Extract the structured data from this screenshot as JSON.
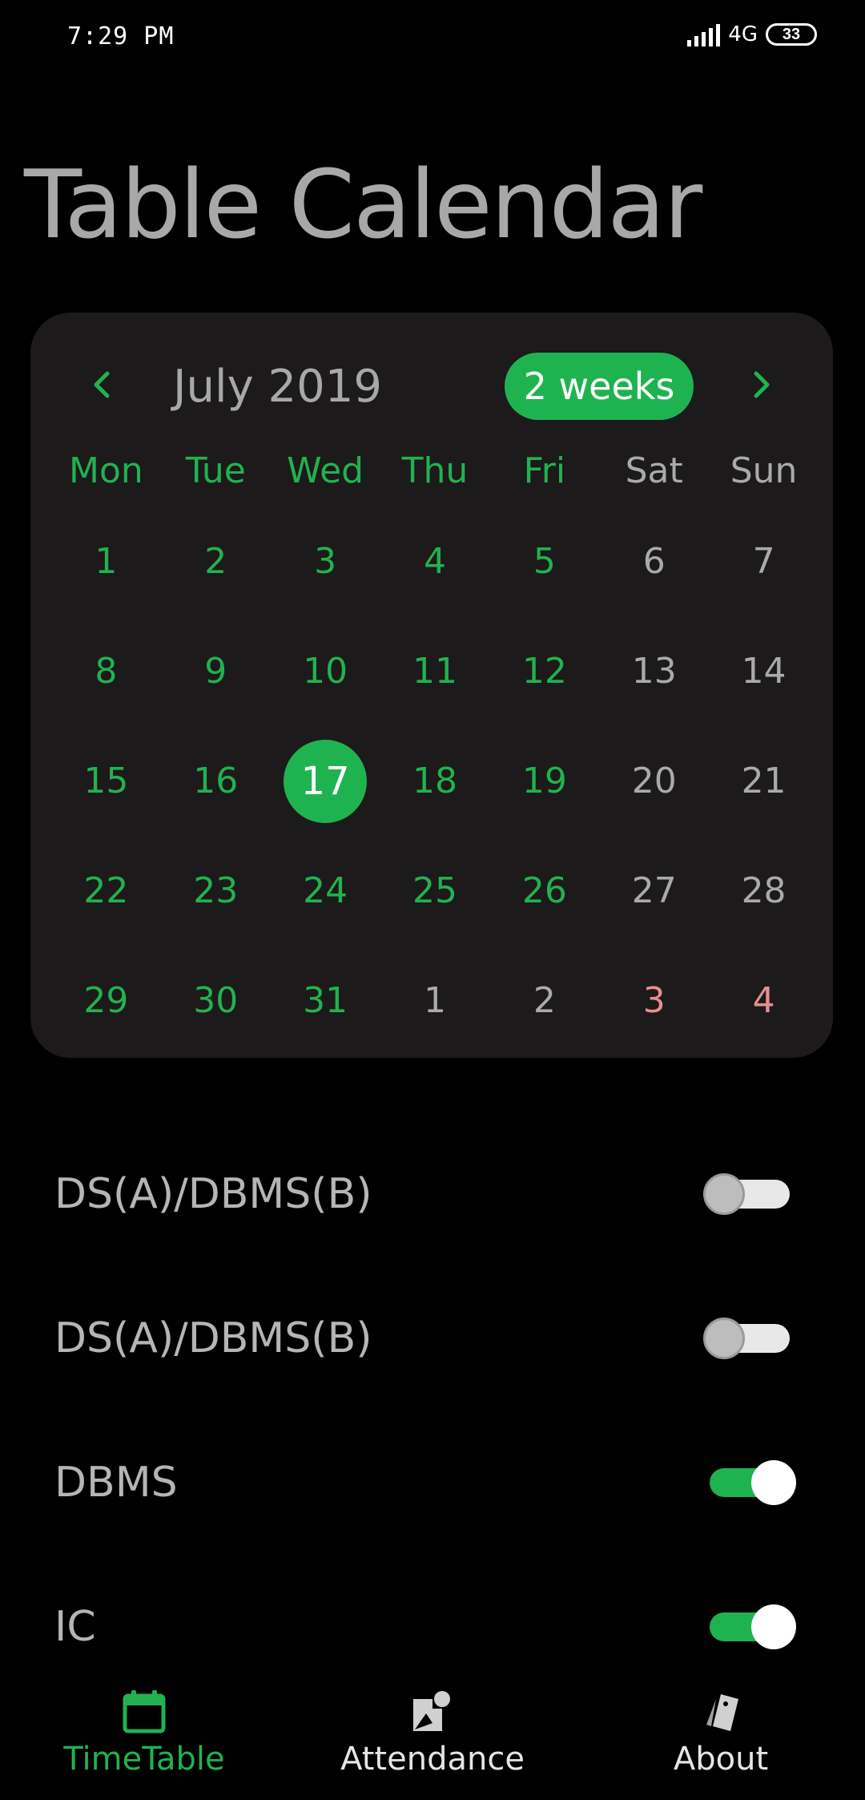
{
  "status_bar": {
    "time": "7:29 PM",
    "network": "4G",
    "battery": "33"
  },
  "page": {
    "title": "Table Calendar"
  },
  "calendar": {
    "month_label": "July 2019",
    "format_button": "2 weeks",
    "weekdays": [
      "Mon",
      "Tue",
      "Wed",
      "Thu",
      "Fri",
      "Sat",
      "Sun"
    ],
    "selected_day": "17",
    "colors": {
      "accent": "#1fb34f",
      "weekday_text": "#21b24f",
      "weekend_text": "#aaaaaa",
      "holiday_text": "#e88e8e",
      "card_background": "#1c1a1a"
    },
    "weeks": [
      [
        "1",
        "2",
        "3",
        "4",
        "5",
        "6",
        "7"
      ],
      [
        "8",
        "9",
        "10",
        "11",
        "12",
        "13",
        "14"
      ],
      [
        "15",
        "16",
        "17",
        "18",
        "19",
        "20",
        "21"
      ],
      [
        "22",
        "23",
        "24",
        "25",
        "26",
        "27",
        "28"
      ],
      [
        "29",
        "30",
        "31",
        "1",
        "2",
        "3",
        "4"
      ]
    ]
  },
  "events": [
    {
      "label": "DS(A)/DBMS(B)",
      "enabled": false
    },
    {
      "label": "DS(A)/DBMS(B)",
      "enabled": false
    },
    {
      "label": "DBMS",
      "enabled": true
    },
    {
      "label": "IC",
      "enabled": true
    }
  ],
  "bottom_nav": {
    "items": [
      {
        "label": "TimeTable",
        "icon": "calendar-icon",
        "active": true
      },
      {
        "label": "Attendance",
        "icon": "attendance-icon",
        "active": false
      },
      {
        "label": "About",
        "icon": "about-icon",
        "active": false
      }
    ]
  }
}
